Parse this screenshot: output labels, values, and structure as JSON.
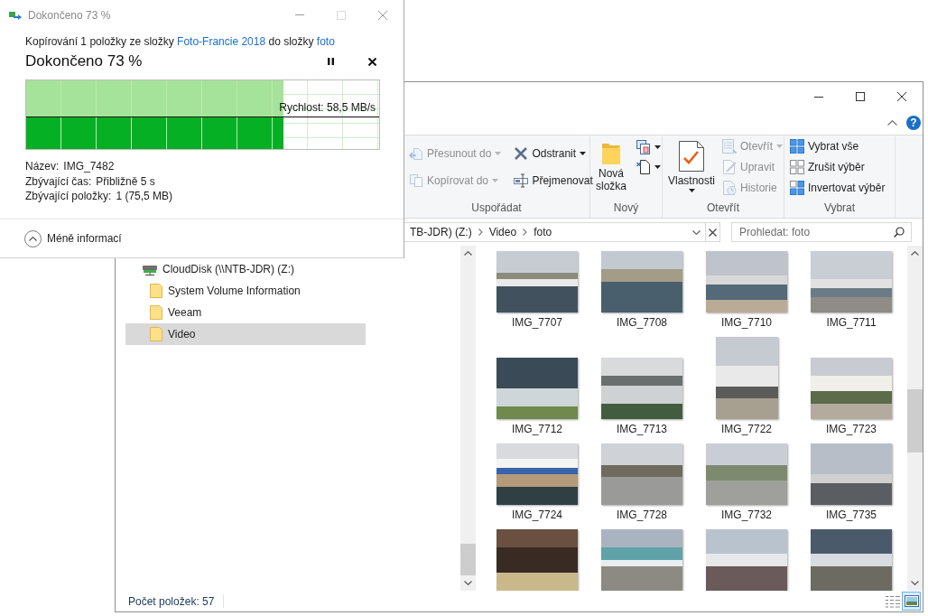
{
  "copy_dialog": {
    "title": "Dokončeno 73 %",
    "description": {
      "before": "Kopírování 1 položky ze složky",
      "source": "Foto-Francie 2018",
      "middle": "do složky",
      "target": "foto"
    },
    "heading": "Dokončeno 73 %",
    "progress": {
      "level": 0.73,
      "reading": "Rychlost: 58,5 MB/s"
    },
    "details": [
      {
        "label": "Název:",
        "value": "IMG_7482"
      },
      {
        "label": "Zbývající čas:",
        "value": "Přibližně 5 s"
      },
      {
        "label": "Zbývající položky:",
        "value": "1 (75,5 MB)"
      }
    ],
    "toggle": "Méně informací"
  },
  "explorer": {
    "help": "?",
    "ribbon": [
      {
        "label": "Uspořádat",
        "columns": [
          [
            {
              "kind": "small",
              "label": "Přesunout do",
              "dropdown": true,
              "disabled": true
            },
            {
              "kind": "small",
              "label": "Kopírovat do",
              "dropdown": true,
              "disabled": true
            }
          ],
          [
            {
              "kind": "small",
              "label": "Odstranit",
              "dropdown": true,
              "disabled": false
            },
            {
              "kind": "small",
              "label": "Přejmenovat",
              "dropdown": false,
              "disabled": false
            }
          ]
        ]
      },
      {
        "label": "Nový",
        "columns": [
          [
            {
              "kind": "large",
              "label": "Nová složka",
              "dropdown": false,
              "disabled": false
            }
          ],
          [
            {
              "kind": "icon",
              "dropdown": true,
              "disabled": false
            },
            {
              "kind": "icon",
              "dropdown": true,
              "disabled": false
            }
          ]
        ]
      },
      {
        "label": "Otevřít",
        "columns": [
          [
            {
              "kind": "large",
              "label": "Vlastnosti",
              "dropdown": true,
              "disabled": false
            }
          ],
          [
            {
              "kind": "small",
              "label": "Otevřít",
              "dropdown": true,
              "disabled": true
            },
            {
              "kind": "small",
              "label": "Upravit",
              "dropdown": false,
              "disabled": true
            },
            {
              "kind": "small",
              "label": "Historie",
              "dropdown": false,
              "disabled": true
            }
          ]
        ]
      },
      {
        "label": "Vybrat",
        "columns": [
          [
            {
              "kind": "small",
              "label": "Vybrat vše",
              "dropdown": false,
              "disabled": false
            },
            {
              "kind": "small",
              "label": "Zrušit výběr",
              "dropdown": false,
              "disabled": false
            },
            {
              "kind": "small",
              "label": "Invertovat výběr",
              "dropdown": false,
              "disabled": false
            }
          ]
        ]
      }
    ],
    "address": {
      "crumbs": [
        "TB-JDR) (Z:)",
        "Video",
        "foto"
      ]
    },
    "search": {
      "placeholder": "Prohledat: foto"
    },
    "tree": [
      {
        "kind": "drive",
        "label": "CloudDisk (\\\\NTB-JDR) (Z:)",
        "selected": false,
        "children": [
          {
            "kind": "folder",
            "label": "System Volume Information",
            "selected": false
          },
          {
            "kind": "folder",
            "label": "Veeam",
            "selected": false
          },
          {
            "kind": "folder",
            "label": "Video",
            "selected": true
          }
        ]
      }
    ],
    "files": [
      {
        "kind": "landscape",
        "name": "IMG_7707"
      },
      {
        "kind": "landscape",
        "name": "IMG_7708"
      },
      {
        "kind": "landscape",
        "name": "IMG_7710"
      },
      {
        "kind": "landscape",
        "name": "IMG_7711"
      },
      {
        "kind": "landscape",
        "name": "IMG_7712"
      },
      {
        "kind": "landscape",
        "name": "IMG_7713"
      },
      {
        "kind": "portrait",
        "name": "IMG_7722"
      },
      {
        "kind": "landscape",
        "name": "IMG_7723"
      },
      {
        "kind": "landscape",
        "name": "IMG_7724"
      },
      {
        "kind": "landscape",
        "name": "IMG_7728"
      },
      {
        "kind": "landscape",
        "name": "IMG_7732"
      },
      {
        "kind": "landscape",
        "name": "IMG_7735"
      },
      {
        "kind": "landscape"
      },
      {
        "kind": "landscape"
      },
      {
        "kind": "landscape"
      },
      {
        "kind": "landscape"
      }
    ],
    "status": "Počet položek: 57",
    "views": [
      {
        "kind": "details",
        "selected": false
      },
      {
        "kind": "large-icons",
        "selected": true
      }
    ]
  }
}
